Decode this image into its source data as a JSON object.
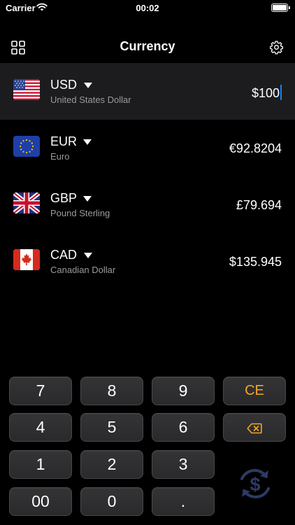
{
  "status_bar": {
    "carrier": "Carrier",
    "time": "00:02"
  },
  "nav": {
    "title": "Currency",
    "left_icon": "grid-icon",
    "right_icon": "gear-icon"
  },
  "currencies": [
    {
      "code": "USD",
      "name": "United States Dollar",
      "amount": "$100",
      "flag": "us-flag-icon",
      "active": true
    },
    {
      "code": "EUR",
      "name": "Euro",
      "amount": "€92.8204",
      "flag": "eu-flag-icon",
      "active": false
    },
    {
      "code": "GBP",
      "name": "Pound Sterling",
      "amount": "£79.694",
      "flag": "gb-flag-icon",
      "active": false
    },
    {
      "code": "CAD",
      "name": "Canadian Dollar",
      "amount": "$135.945",
      "flag": "ca-flag-icon",
      "active": false
    }
  ],
  "keypad": {
    "k7": "7",
    "k8": "8",
    "k9": "9",
    "ce": "CE",
    "k4": "4",
    "k5": "5",
    "k6": "6",
    "backspace_icon": "backspace-icon",
    "k1": "1",
    "k2": "2",
    "k3": "3",
    "k00": "00",
    "k0": "0",
    "dot": "."
  },
  "convert_icon": "currency-swap-icon",
  "colors": {
    "accent_orange": "#f5a623",
    "cursor_blue": "#0a84ff",
    "convert_icon": "#2e3a66",
    "active_row": "#1c1c1e"
  }
}
